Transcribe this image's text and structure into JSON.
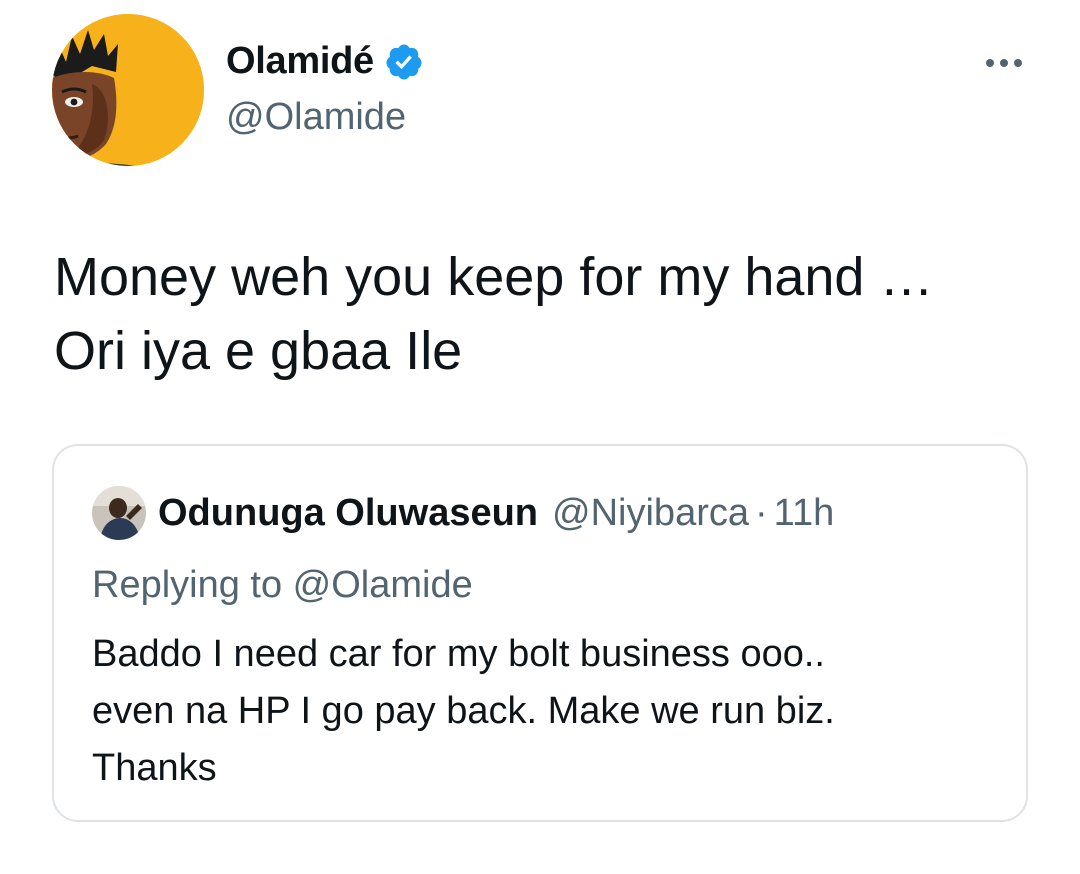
{
  "tweet": {
    "author": {
      "name": "Olamidé",
      "handle": "@Olamide",
      "verified": true,
      "avatar_icon": "avatar-cartoon-portrait",
      "avatar_bg": "#f7b21b"
    },
    "more_icon": "more-horizontal-icon",
    "text_lines": [
      "Money weh you keep for my hand …",
      "Ori iya e gbaa Ile"
    ]
  },
  "quoted": {
    "author": {
      "name": "Odunuga Oluwaseun",
      "handle": "@Niyibarca",
      "avatar_icon": "avatar-photo"
    },
    "separator": "·",
    "time": "11h",
    "replying_to": "Replying to @Olamide",
    "text_lines": [
      "Baddo I need car for my bolt business ooo..",
      "even na HP I go pay back. Make we run biz.",
      "Thanks"
    ]
  },
  "colors": {
    "text_primary": "#0f1419",
    "text_secondary": "#536471",
    "verified_badge": "#1d9bf0",
    "card_border": "#dfe3e6"
  }
}
